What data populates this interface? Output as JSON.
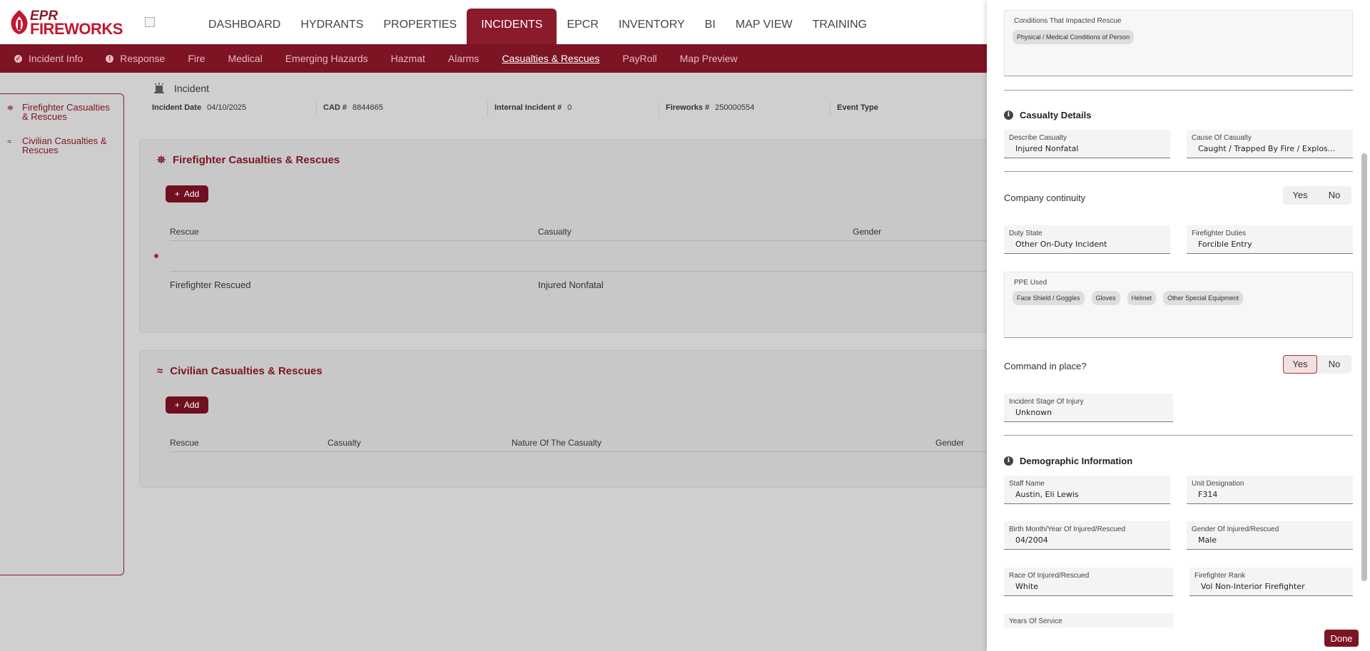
{
  "brand": {
    "line1": "EPR",
    "line2": "FIREWORKS"
  },
  "topnav": {
    "items": [
      "DASHBOARD",
      "HYDRANTS",
      "PROPERTIES",
      "INCIDENTS",
      "EPCR",
      "INVENTORY",
      "BI",
      "MAP VIEW",
      "TRAINING"
    ],
    "active": "INCIDENTS"
  },
  "subnav": {
    "items": [
      "Incident Info",
      "Response",
      "Fire",
      "Medical",
      "Emerging Hazards",
      "Hazmat",
      "Alarms",
      "Casualties & Rescues",
      "PayRoll",
      "Map Preview"
    ],
    "active": "Casualties & Rescues"
  },
  "sidebar": {
    "items": [
      {
        "label_l1": "Firefighter Casualties",
        "label_l2": "& Rescues"
      },
      {
        "label_l1": "Civilian Casualties &",
        "label_l2": "Rescues"
      }
    ]
  },
  "incident": {
    "title": "Incident",
    "date_label": "Incident Date",
    "date_value": "04/10/2025",
    "cad_label": "CAD #",
    "cad_value": "8844665",
    "internal_label": "Internal Incident #",
    "internal_value": "0",
    "fireworks_label": "Fireworks #",
    "fireworks_value": "250000554",
    "event_label": "Event Type"
  },
  "ff_card": {
    "title": "Firefighter Casualties & Rescues",
    "add_label": "Add",
    "columns": [
      "Rescue",
      "Casualty",
      "Gender"
    ],
    "rows": [
      {
        "rescue": "Firefighter Rescued",
        "casualty": "Injured Nonfatal"
      }
    ]
  },
  "civ_card": {
    "title": "Civilian Casualties & Rescues",
    "add_label": "Add",
    "columns": [
      "Rescue",
      "Casualty",
      "Nature Of The Casualty",
      "Gender"
    ]
  },
  "drawer": {
    "conditions": {
      "label": "Conditions That Impacted Rescue",
      "tags": [
        "Physical / Medical Conditions of Person"
      ]
    },
    "casualty_details": {
      "title": "Casualty Details",
      "describe_label": "Describe Casualty",
      "describe_value": "Injured Nonfatal",
      "cause_label": "Cause Of Casualty",
      "cause_value": "Caught / Trapped By Fire / Explos..."
    },
    "company_continuity": {
      "label": "Company continuity",
      "yes": "Yes",
      "no": "No",
      "selected": "none"
    },
    "duty_state": {
      "label": "Duty State",
      "value": "Other On-Duty Incident"
    },
    "ff_duties": {
      "label": "Firefighter Duties",
      "value": "Forcible Entry"
    },
    "ppe": {
      "label": "PPE Used",
      "tags": [
        "Face Shield / Goggles",
        "Gloves",
        "Helmet",
        "Other Special Equipment"
      ]
    },
    "command": {
      "label": "Command in place?",
      "yes": "Yes",
      "no": "No",
      "selected": "Yes"
    },
    "stage": {
      "label": "Incident Stage Of Injury",
      "value": "Unknown"
    },
    "demographic": {
      "title": "Demographic Information",
      "staff_label": "Staff Name",
      "staff_value": "Austin, Eli Lewis",
      "unit_label": "Unit Designation",
      "unit_value": "F314",
      "birth_label": "Birth Month/Year Of Injured/Rescued",
      "birth_value": "04/2004",
      "gender_label": "Gender Of Injured/Rescued",
      "gender_value": "Male",
      "race_label": "Race Of Injured/Rescued",
      "race_value": "White",
      "rank_label": "Firefighter Rank",
      "rank_value": "Vol Non-Interior Firefighter",
      "years_label": "Years Of Service"
    },
    "done_label": "Done"
  },
  "colors": {
    "brand": "#8b1a2b",
    "subnav": "#7d1424",
    "accent": "#c2182f"
  }
}
